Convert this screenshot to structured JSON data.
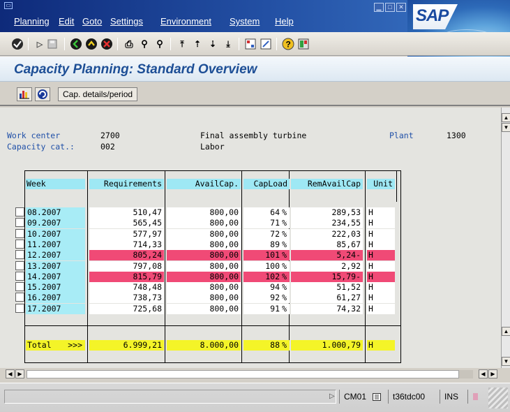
{
  "menu": [
    "Planning",
    "Edit",
    "Goto",
    "Settings",
    "Environment",
    "System",
    "Help"
  ],
  "sap_logo_text": "SAP",
  "title": "Capacity Planning: Standard Overview",
  "app_toolbar": {
    "cap_details_label": "Cap. details/period"
  },
  "header": {
    "work_center_label": "Work center",
    "work_center_value": "2700",
    "work_center_desc": "Final assembly turbine",
    "plant_label": "Plant",
    "plant_value": "1300",
    "capacity_cat_label": "Capacity cat.:",
    "capacity_cat_value": "002",
    "capacity_cat_desc": "Labor"
  },
  "grid": {
    "columns": [
      "Week",
      "Requirements",
      "AvailCap.",
      "CapLoad",
      "RemAvailCap",
      "Unit"
    ],
    "rows": [
      {
        "week": "08.2007",
        "req": "510,47",
        "avail": "800,00",
        "load": "64",
        "pct": "%",
        "rem": "289,53",
        "unit": "H",
        "over": false
      },
      {
        "week": "09.2007",
        "req": "565,45",
        "avail": "800,00",
        "load": "71",
        "pct": "%",
        "rem": "234,55",
        "unit": "H",
        "over": false
      },
      {
        "week": "10.2007",
        "req": "577,97",
        "avail": "800,00",
        "load": "72",
        "pct": "%",
        "rem": "222,03",
        "unit": "H",
        "over": false
      },
      {
        "week": "11.2007",
        "req": "714,33",
        "avail": "800,00",
        "load": "89",
        "pct": "%",
        "rem": "85,67",
        "unit": "H",
        "over": false
      },
      {
        "week": "12.2007",
        "req": "805,24",
        "avail": "800,00",
        "load": "101",
        "pct": "%",
        "rem": "5,24-",
        "unit": "H",
        "over": true
      },
      {
        "week": "13.2007",
        "req": "797,08",
        "avail": "800,00",
        "load": "100",
        "pct": "%",
        "rem": "2,92",
        "unit": "H",
        "over": false
      },
      {
        "week": "14.2007",
        "req": "815,79",
        "avail": "800,00",
        "load": "102",
        "pct": "%",
        "rem": "15,79-",
        "unit": "H",
        "over": true
      },
      {
        "week": "15.2007",
        "req": "748,48",
        "avail": "800,00",
        "load": "94",
        "pct": "%",
        "rem": "51,52",
        "unit": "H",
        "over": false
      },
      {
        "week": "16.2007",
        "req": "738,73",
        "avail": "800,00",
        "load": "92",
        "pct": "%",
        "rem": "61,27",
        "unit": "H",
        "over": false
      },
      {
        "week": "17.2007",
        "req": "725,68",
        "avail": "800,00",
        "load": "91",
        "pct": "%",
        "rem": "74,32",
        "unit": "H",
        "over": false
      }
    ],
    "total": {
      "label": "Total",
      "arrows": ">>>",
      "req": "6.999,21",
      "avail": "8.000,00",
      "load": "88",
      "pct": "%",
      "rem": "1.000,79",
      "unit": "H"
    }
  },
  "status": {
    "transaction": "CM01",
    "server": "t36tdc00",
    "mode": "INS"
  },
  "colors": {
    "overload": "#f04a76",
    "total": "#f4f428",
    "column_header": "#9ee8f4",
    "title": "#1e4f96"
  }
}
